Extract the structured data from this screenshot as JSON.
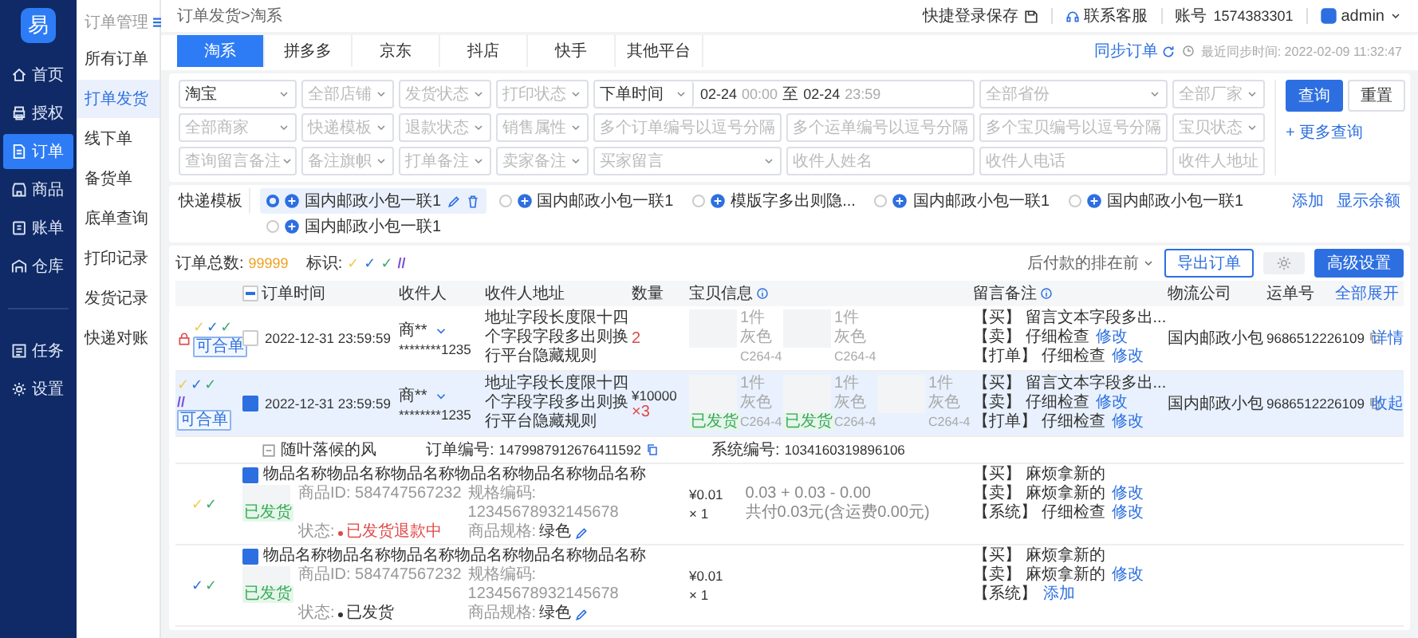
{
  "sidebar": {
    "logo": "易",
    "items": [
      {
        "label": "首页",
        "selected": false
      },
      {
        "label": "授权",
        "selected": false
      },
      {
        "label": "订单",
        "selected": true
      },
      {
        "label": "商品",
        "selected": false
      },
      {
        "label": "账单",
        "selected": false
      },
      {
        "label": "仓库",
        "selected": false
      }
    ],
    "bottom_items": [
      {
        "label": "任务",
        "selected": false
      },
      {
        "label": "设置",
        "selected": false
      }
    ]
  },
  "submenu": {
    "title": "订单管理",
    "items": [
      {
        "label": "所有订单",
        "selected": false
      },
      {
        "label": "打单发货",
        "selected": true
      },
      {
        "label": "线下单",
        "selected": false
      },
      {
        "label": "备货单",
        "selected": false
      },
      {
        "label": "底单查询",
        "selected": false
      },
      {
        "label": "打印记录",
        "selected": false
      },
      {
        "label": "发货记录",
        "selected": false
      },
      {
        "label": "快递对账",
        "selected": false
      }
    ]
  },
  "header": {
    "breadcrumb": "订单发货>淘系",
    "quick_save": "快捷登录保存",
    "support": "联系客服",
    "account_label": "账号",
    "account": "1574383301",
    "user": "admin"
  },
  "platform_tabs": [
    {
      "label": "淘系",
      "selected": true
    },
    {
      "label": "拼多多",
      "selected": false
    },
    {
      "label": "京东",
      "selected": false
    },
    {
      "label": "抖店",
      "selected": false
    },
    {
      "label": "快手",
      "selected": false
    },
    {
      "label": "其他平台",
      "selected": false
    }
  ],
  "sync": {
    "action": "同步订单",
    "last_sync": "最近同步时间: 2022-02-09 11:32:47"
  },
  "filters": {
    "rows": [
      [
        {
          "kind": "select",
          "value": "淘宝"
        },
        {
          "kind": "select",
          "placeholder": "全部店铺"
        },
        {
          "kind": "select",
          "placeholder": "发货状态"
        },
        {
          "kind": "select",
          "placeholder": "打印状态"
        },
        {
          "kind": "daterange",
          "value": "下单时间",
          "start_date": "02-24",
          "start_time": "00:00",
          "separator": "至",
          "end_date": "02-24",
          "end_time": "23:59"
        },
        "",
        {
          "kind": "select",
          "placeholder": "全部省份"
        },
        {
          "kind": "select",
          "placeholder": "全部厂家"
        }
      ],
      [
        {
          "kind": "select",
          "placeholder": "全部商家"
        },
        {
          "kind": "select",
          "placeholder": "快递模板"
        },
        {
          "kind": "select",
          "placeholder": "退款状态"
        },
        {
          "kind": "select",
          "placeholder": "销售属性"
        },
        {
          "kind": "input",
          "placeholder": "多个订单编号以逗号分隔"
        },
        {
          "kind": "input",
          "placeholder": "多个运单编号以逗号分隔"
        },
        {
          "kind": "input",
          "placeholder": "多个宝贝编号以逗号分隔"
        },
        {
          "kind": "select",
          "placeholder": "宝贝状态"
        }
      ],
      [
        {
          "kind": "select",
          "placeholder": "查询留言备注"
        },
        {
          "kind": "select",
          "placeholder": "备注旗帜"
        },
        {
          "kind": "select",
          "placeholder": "打单备注"
        },
        {
          "kind": "select",
          "placeholder": "卖家备注"
        },
        {
          "kind": "select",
          "placeholder": "买家留言"
        },
        {
          "kind": "input",
          "placeholder": "收件人姓名"
        },
        {
          "kind": "input",
          "placeholder": "收件人电话"
        },
        {
          "kind": "input",
          "placeholder": "收件人地址"
        }
      ]
    ],
    "search": "查询",
    "reset": "重置",
    "more": "+ 更多查询"
  },
  "templates": {
    "label": "快递模板",
    "items": [
      {
        "name": "国内邮政小包一联1",
        "selected": true
      },
      {
        "name": "国内邮政小包一联1",
        "selected": false
      },
      {
        "name": "模版字多出则隐...",
        "selected": false
      },
      {
        "name": "国内邮政小包一联1",
        "selected": false
      },
      {
        "name": "国内邮政小包一联1",
        "selected": false
      },
      {
        "name": "国内邮政小包一联1",
        "selected": false
      }
    ],
    "add": "添加",
    "balance": "显示余额"
  },
  "toolbar": {
    "total_label": "订单总数:",
    "total": "99999",
    "markers_label": "标识:",
    "markers": [
      {
        "symbol": "✓",
        "color": "#f2c94c"
      },
      {
        "symbol": "✓",
        "color": "#2f6fd6"
      },
      {
        "symbol": "✓",
        "color": "#3aa76d"
      },
      {
        "symbol": "//",
        "color": "#7b4fd6"
      }
    ],
    "sort": "后付款的排在前",
    "export": "导出订单",
    "advanced": "高级设置"
  },
  "table": {
    "select_all_indeterminate": true,
    "columns": [
      {
        "label": "订单时间"
      },
      {
        "label": "收件人"
      },
      {
        "label": "收件人地址"
      },
      {
        "label": "数量"
      },
      {
        "label": "宝贝信息",
        "info": true
      },
      {
        "label": "留言备注",
        "info": true
      },
      {
        "label": "物流公司"
      },
      {
        "label": "运单号"
      }
    ],
    "expand_all": "全部展开",
    "orders": [
      {
        "locked": true,
        "markers": [
          {
            "symbol": "✓",
            "color": "#f2c94c"
          },
          {
            "symbol": "✓",
            "color": "#2f6fd6"
          },
          {
            "symbol": "✓",
            "color": "#3aa76d"
          }
        ],
        "tag": "可合单",
        "checked": false,
        "selected": false,
        "time": "2022-12-31 23:59:59",
        "recipient_name": "商**",
        "recipient_phone": "********1235",
        "address": "地址字段长度限十四个字段字段多出则换行平台隐藏规则",
        "count": "2",
        "count_alert": true,
        "items": [
          {
            "qty": "1件",
            "variant": "灰色",
            "sku": "C264-4"
          },
          {
            "qty": "1件",
            "variant": "灰色",
            "sku": "C264-4"
          }
        ],
        "remarks": [
          {
            "text": "【买】 留言文本字段多出..."
          },
          {
            "text": "【卖】 仔细检查",
            "link": "修改"
          },
          {
            "text": "【打单】 仔细检查",
            "link": "修改"
          }
        ],
        "logistics": "国内邮政小包",
        "tracking": "9686512226109",
        "action": "详情"
      },
      {
        "locked": false,
        "markers": [
          {
            "symbol": "✓",
            "color": "#f2c94c"
          },
          {
            "symbol": "✓",
            "color": "#2f6fd6"
          },
          {
            "symbol": "✓",
            "color": "#3aa76d"
          },
          {
            "symbol": "//",
            "color": "#7b4fd6"
          }
        ],
        "tag": "可合单",
        "checked": true,
        "selected": true,
        "time": "2022-12-31 23:59:59",
        "recipient_name": "商**",
        "recipient_phone": "********1235",
        "address": "地址字段长度限十四个字段字段多出则换行平台隐藏规则",
        "price": "¥10000",
        "count": "×3",
        "count_alert": true,
        "items": [
          {
            "qty": "1件",
            "variant": "灰色",
            "sku": "C264-4",
            "badge": "已发货"
          },
          {
            "qty": "1件",
            "variant": "灰色",
            "sku": "C264-4",
            "badge": "已发货"
          },
          {
            "qty": "1件",
            "variant": "灰色",
            "sku": "C264-4"
          }
        ],
        "remarks": [
          {
            "text": "【买】 留言文本字段多出..."
          },
          {
            "text": "【卖】 仔细检查",
            "link": "修改"
          },
          {
            "text": "【打单】 仔细检查",
            "link": "修改"
          }
        ],
        "logistics": "国内邮政小包",
        "tracking": "9686512226109",
        "action": "收起",
        "detail": {
          "buyer": "随叶落候的风",
          "order_no_label": "订单编号:",
          "order_no": "1479987912676411592",
          "system_no_label": "系统编号:",
          "system_no": "1034160319896106",
          "lines": [
            {
              "markers": [
                {
                  "symbol": "✓",
                  "color": "#f2c94c"
                },
                {
                  "symbol": "✓",
                  "color": "#3aa76d"
                }
              ],
              "checked": true,
              "title": "物品名称物品名称物品名称物品名称物品名称物品名称",
              "tag": "已发货",
              "product_id": "商品ID: 584747567232",
              "status_label": "状态:",
              "status": "已发货退款中",
              "status_alert": true,
              "spec_code": "规格编码: 12345678932145678",
              "spec_label": "商品规格:",
              "spec": "绿色",
              "price": "¥0.01",
              "count": "× 1",
              "payment": [
                "0.03 + 0.03 - 0.00",
                "共付0.03元(含运费0.00元)"
              ],
              "remarks": [
                {
                  "text": "【买】 麻烦拿新的"
                },
                {
                  "text": "【卖】 麻烦拿新的",
                  "link": "修改"
                },
                {
                  "text": "【系统】 仔细检查",
                  "link": "修改"
                }
              ]
            },
            {
              "markers": [
                {
                  "symbol": "✓",
                  "color": "#2f6fd6"
                },
                {
                  "symbol": "✓",
                  "color": "#3aa76d"
                }
              ],
              "checked": true,
              "title": "物品名称物品名称物品名称物品名称物品名称物品名称",
              "tag": "已发货",
              "product_id": "商品ID: 584747567232",
              "status_label": "状态:",
              "status": "已发货",
              "status_alert": false,
              "spec_code": "规格编码: 12345678932145678",
              "spec_label": "商品规格:",
              "spec": "绿色",
              "price": "¥0.01",
              "count": "× 1",
              "remarks": [
                {
                  "text": "【买】 麻烦拿新的"
                },
                {
                  "text": "【卖】 麻烦拿新的",
                  "link": "修改"
                },
                {
                  "text": "【系统】",
                  "link": "添加"
                }
              ]
            }
          ]
        }
      }
    ]
  }
}
